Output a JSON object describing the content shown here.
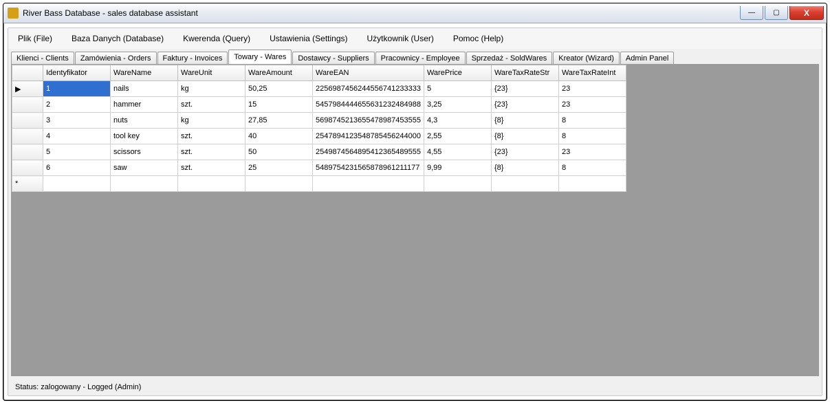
{
  "window": {
    "title": "River Bass Database - sales database assistant"
  },
  "menu": {
    "items": [
      "Plik (File)",
      "Baza Danych (Database)",
      "Kwerenda (Query)",
      "Ustawienia (Settings)",
      "Użytkownik (User)",
      "Pomoc (Help)"
    ]
  },
  "tabs": {
    "items": [
      "Klienci - Clients",
      "Zamówienia - Orders",
      "Faktury - Invoices",
      "Towary - Wares",
      "Dostawcy - Suppliers",
      "Pracownicy - Employee",
      "Sprzedaż - SoldWares",
      "Kreator (Wizard)",
      "Admin Panel"
    ],
    "active_index": 3
  },
  "grid": {
    "columns": [
      "Identyfikator",
      "WareName",
      "WareUnit",
      "WareAmount",
      "WareEAN",
      "WarePrice",
      "WareTaxRateStr",
      "WareTaxRateInt"
    ],
    "rows": [
      {
        "id": "1",
        "name": "nails",
        "unit": "kg",
        "amount": "50,25",
        "ean": "2256987456244556741233333",
        "price": "5",
        "taxstr": "{23}",
        "taxint": "23"
      },
      {
        "id": "2",
        "name": "hammer",
        "unit": "szt.",
        "amount": "15",
        "ean": "5457984444655631232484988",
        "price": "3,25",
        "taxstr": "{23}",
        "taxint": "23"
      },
      {
        "id": "3",
        "name": "nuts",
        "unit": "kg",
        "amount": "27,85",
        "ean": "5698745213655478987453555",
        "price": "4,3",
        "taxstr": "{8}",
        "taxint": "8"
      },
      {
        "id": "4",
        "name": "tool key",
        "unit": "szt.",
        "amount": "40",
        "ean": "2547894123548785456244000",
        "price": "2,55",
        "taxstr": "{8}",
        "taxint": "8"
      },
      {
        "id": "5",
        "name": "scissors",
        "unit": "szt.",
        "amount": "50",
        "ean": "2549874564895412365489555",
        "price": "4,55",
        "taxstr": "{23}",
        "taxint": "23"
      },
      {
        "id": "6",
        "name": "saw",
        "unit": "szt.",
        "amount": "25",
        "ean": "5489754231565878961211177",
        "price": "9,99",
        "taxstr": "{8}",
        "taxint": "8"
      }
    ],
    "current_row_marker": "▶",
    "new_row_marker": "*"
  },
  "status": {
    "text": "Status: zalogowany - Logged (Admin)"
  },
  "winbtn": {
    "min": "—",
    "max": "▢",
    "close": "X"
  }
}
